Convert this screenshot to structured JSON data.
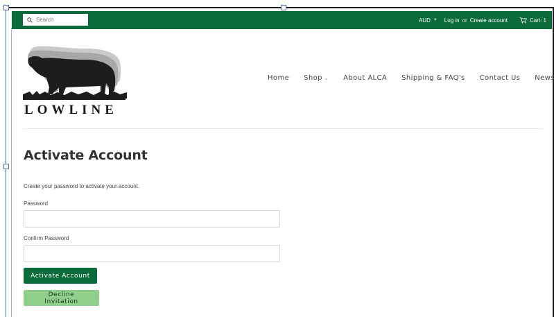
{
  "topbar": {
    "search_placeholder": "Search",
    "currency": "AUD",
    "login": "Log in",
    "or": "or",
    "create_account": "Create account",
    "cart": "Cart: 1"
  },
  "logo": {
    "text": "LOWLINE"
  },
  "nav": {
    "items": [
      "Home",
      "Shop",
      "About ALCA",
      "Shipping & FAQ's",
      "Contact Us",
      "News"
    ]
  },
  "page": {
    "title": "Activate Account",
    "description": "Create your password to activate your account.",
    "password_label": "Password",
    "confirm_label": "Confirm Password",
    "activate_button": "Activate Account",
    "decline_button": "Decline Invitation"
  },
  "colors": {
    "brand_green": "#0b6b3a",
    "light_green": "#8fcf8b"
  }
}
